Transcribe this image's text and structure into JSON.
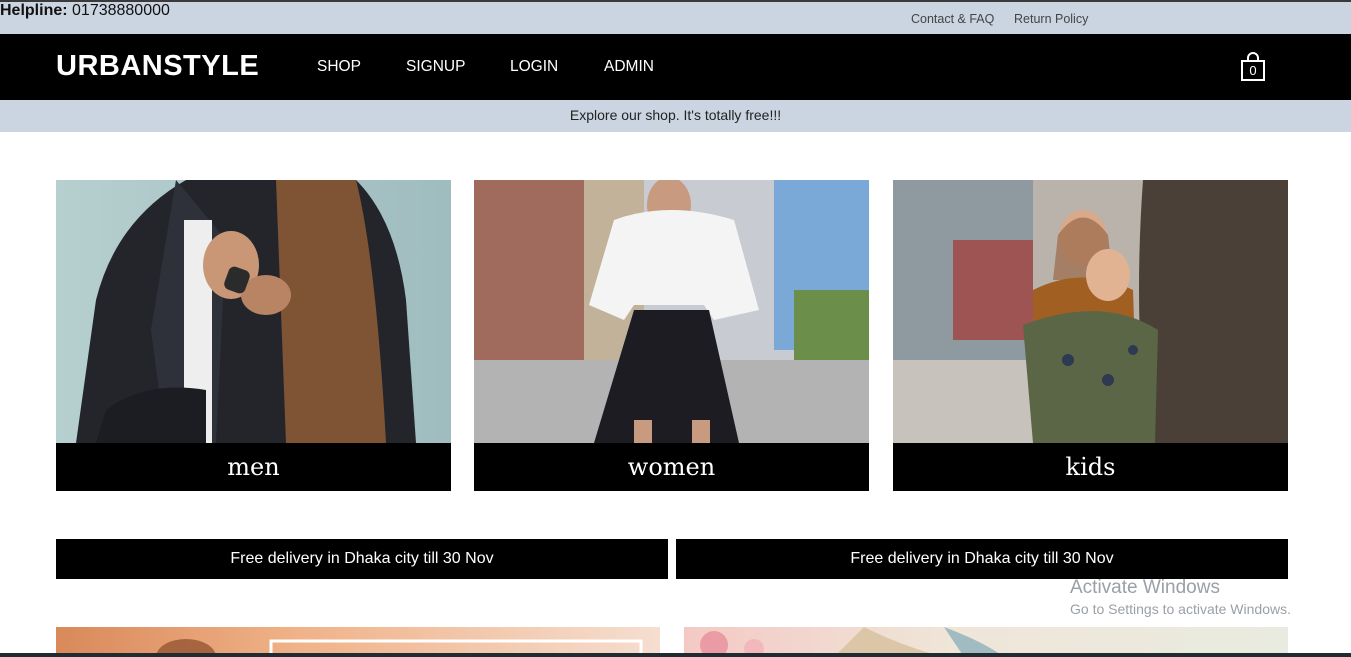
{
  "topbar": {
    "contact_link": "Contact & FAQ",
    "return_link": "Return Policy",
    "helpline_label": "Helpline:",
    "helpline_number": "01738880000"
  },
  "navbar": {
    "logo": "URBANSTYLE",
    "links": [
      "SHOP",
      "SIGNUP",
      "LOGIN",
      "ADMIN"
    ],
    "cart_count": "0",
    "cart_icon": "shopping-bag-icon"
  },
  "promo_strip": "Explore our shop. It's totally free!!!",
  "categories": [
    {
      "label": "men"
    },
    {
      "label": "women"
    },
    {
      "label": "kids"
    }
  ],
  "offers": [
    "Free delivery in Dhaka city till 30 Nov",
    "Free delivery in Dhaka city till 30 Nov"
  ],
  "watermark": {
    "title": "Activate Windows",
    "subtitle": "Go to Settings to activate Windows."
  },
  "colors": {
    "topbar_bg": "#cbd5e1",
    "navbar_bg": "#000000",
    "text_light": "#ffffff"
  }
}
